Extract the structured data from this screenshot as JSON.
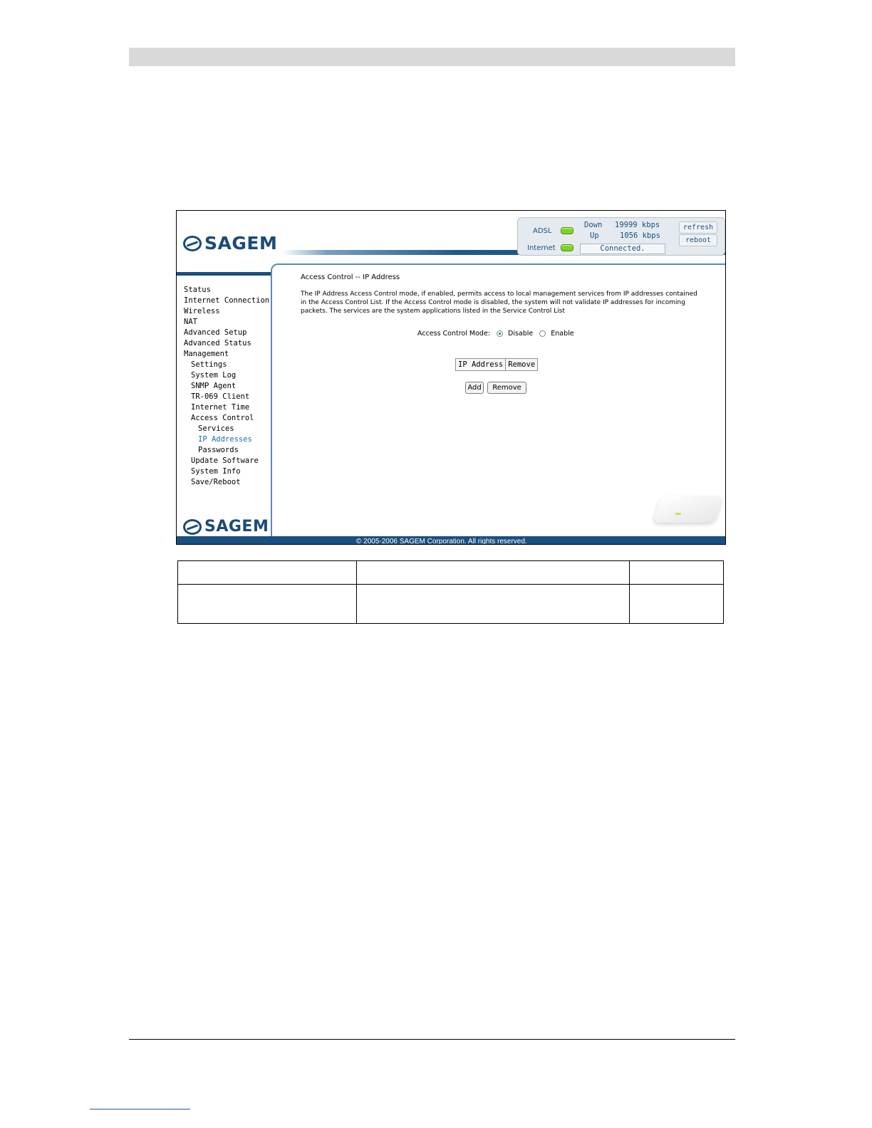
{
  "brand": {
    "logo_text": "SAGEM"
  },
  "status_panel": {
    "adsl_label": "ADSL",
    "internet_label": "Internet",
    "down_label": "Down",
    "down_value": "19999 kbps",
    "up_label": "Up",
    "up_value": "1056 kbps",
    "connection_status": "Connected.",
    "refresh_label": "refresh",
    "reboot_label": "reboot"
  },
  "sidebar": {
    "items": [
      {
        "label": "Status",
        "level": 1
      },
      {
        "label": "Internet Connection",
        "level": 1
      },
      {
        "label": "Wireless",
        "level": 1
      },
      {
        "label": "NAT",
        "level": 1
      },
      {
        "label": "Advanced Setup",
        "level": 1
      },
      {
        "label": "Advanced Status",
        "level": 1
      },
      {
        "label": "Management",
        "level": 1
      },
      {
        "label": "Settings",
        "level": 2
      },
      {
        "label": "System Log",
        "level": 2
      },
      {
        "label": "SNMP Agent",
        "level": 2
      },
      {
        "label": "TR-069 Client",
        "level": 2
      },
      {
        "label": "Internet Time",
        "level": 2
      },
      {
        "label": "Access Control",
        "level": 2
      },
      {
        "label": "Services",
        "level": 3
      },
      {
        "label": "IP Addresses",
        "level": 3,
        "active": true
      },
      {
        "label": "Passwords",
        "level": 3
      },
      {
        "label": "Update Software",
        "level": 2
      },
      {
        "label": "System Info",
        "level": 2
      },
      {
        "label": "Save/Reboot",
        "level": 2
      }
    ]
  },
  "main": {
    "title": "Access Control -- IP Address",
    "description": "The IP Address Access Control mode, if enabled, permits access to local management services from IP addresses contained in the Access Control List. If the Access Control mode is disabled, the system will not validate IP addresses for incoming packets. The services are the system applications listed in the Service Control List",
    "mode_label": "Access Control Mode:",
    "mode_options": [
      {
        "label": "Disable",
        "checked": true
      },
      {
        "label": "Enable",
        "checked": false
      }
    ],
    "table_headers": [
      "IP Address",
      "Remove"
    ],
    "add_label": "Add",
    "remove_label": "Remove"
  },
  "footer": {
    "copyright": "© 2005-2006 SAGEM Corporation. All rights reserved."
  },
  "colors": {
    "brand_blue": "#1a4f80",
    "led_green": "#7fd321",
    "active_link": "#1b6ea8"
  }
}
